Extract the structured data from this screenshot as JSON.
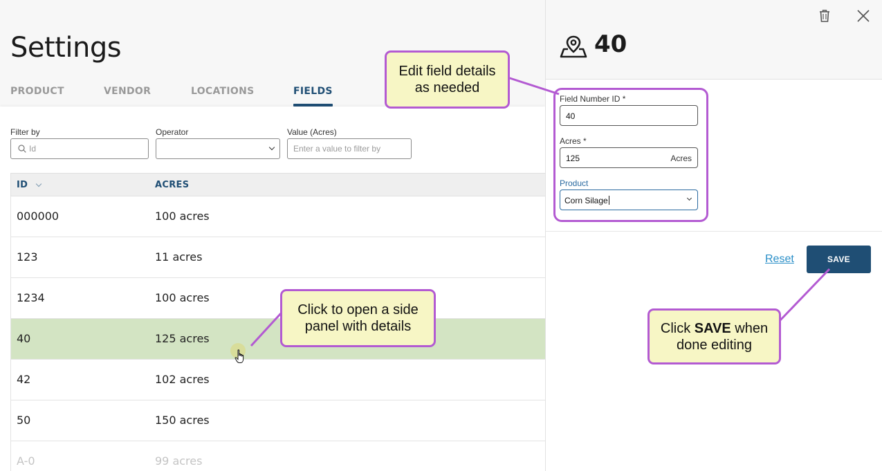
{
  "page": {
    "title": "Settings",
    "tabs": [
      {
        "label": "PRODUCT",
        "active": false
      },
      {
        "label": "VENDOR",
        "active": false
      },
      {
        "label": "LOCATIONS",
        "active": false
      },
      {
        "label": "FIELDS",
        "active": true
      }
    ]
  },
  "filters": {
    "filter_by_label": "Filter by",
    "filter_by_placeholder": "Id",
    "operator_label": "Operator",
    "operator_value": "",
    "value_label": "Value (Acres)",
    "value_placeholder": "Enter a value to filter by"
  },
  "table": {
    "columns": [
      "ID",
      "ACRES"
    ],
    "rows": [
      {
        "id": "000000",
        "acres": "100 acres"
      },
      {
        "id": "123",
        "acres": "11 acres"
      },
      {
        "id": "1234",
        "acres": "100 acres"
      },
      {
        "id": "40",
        "acres": "125 acres",
        "selected": true
      },
      {
        "id": "42",
        "acres": "102 acres"
      },
      {
        "id": "50",
        "acres": "150 acres"
      },
      {
        "id": "A-0",
        "acres": "99 acres"
      }
    ]
  },
  "panel": {
    "title": "40",
    "icons": {
      "delete": "trash-icon",
      "close": "close-icon",
      "header": "map-pin-icon"
    },
    "field_number_label": "Field Number ID *",
    "field_number_value": "40",
    "acres_label": "Acres *",
    "acres_value": "125",
    "acres_suffix": "Acres",
    "product_label": "Product",
    "product_value": "Corn Silage",
    "reset_label": "Reset",
    "save_label": "SAVE"
  },
  "callouts": {
    "edit": [
      "Edit field details",
      "as needed"
    ],
    "click_row": [
      "Click to open a side",
      "panel with details"
    ],
    "save_prefix": "Click ",
    "save_bold": "SAVE",
    "save_suffix": " when",
    "save_line2": "done editing"
  },
  "colors": {
    "accent": "#1f4e74",
    "selected_row": "#d3e4c3",
    "callout_fill": "#f7f6c5",
    "callout_border": "#b35ad2",
    "link": "#2a8fc8"
  }
}
